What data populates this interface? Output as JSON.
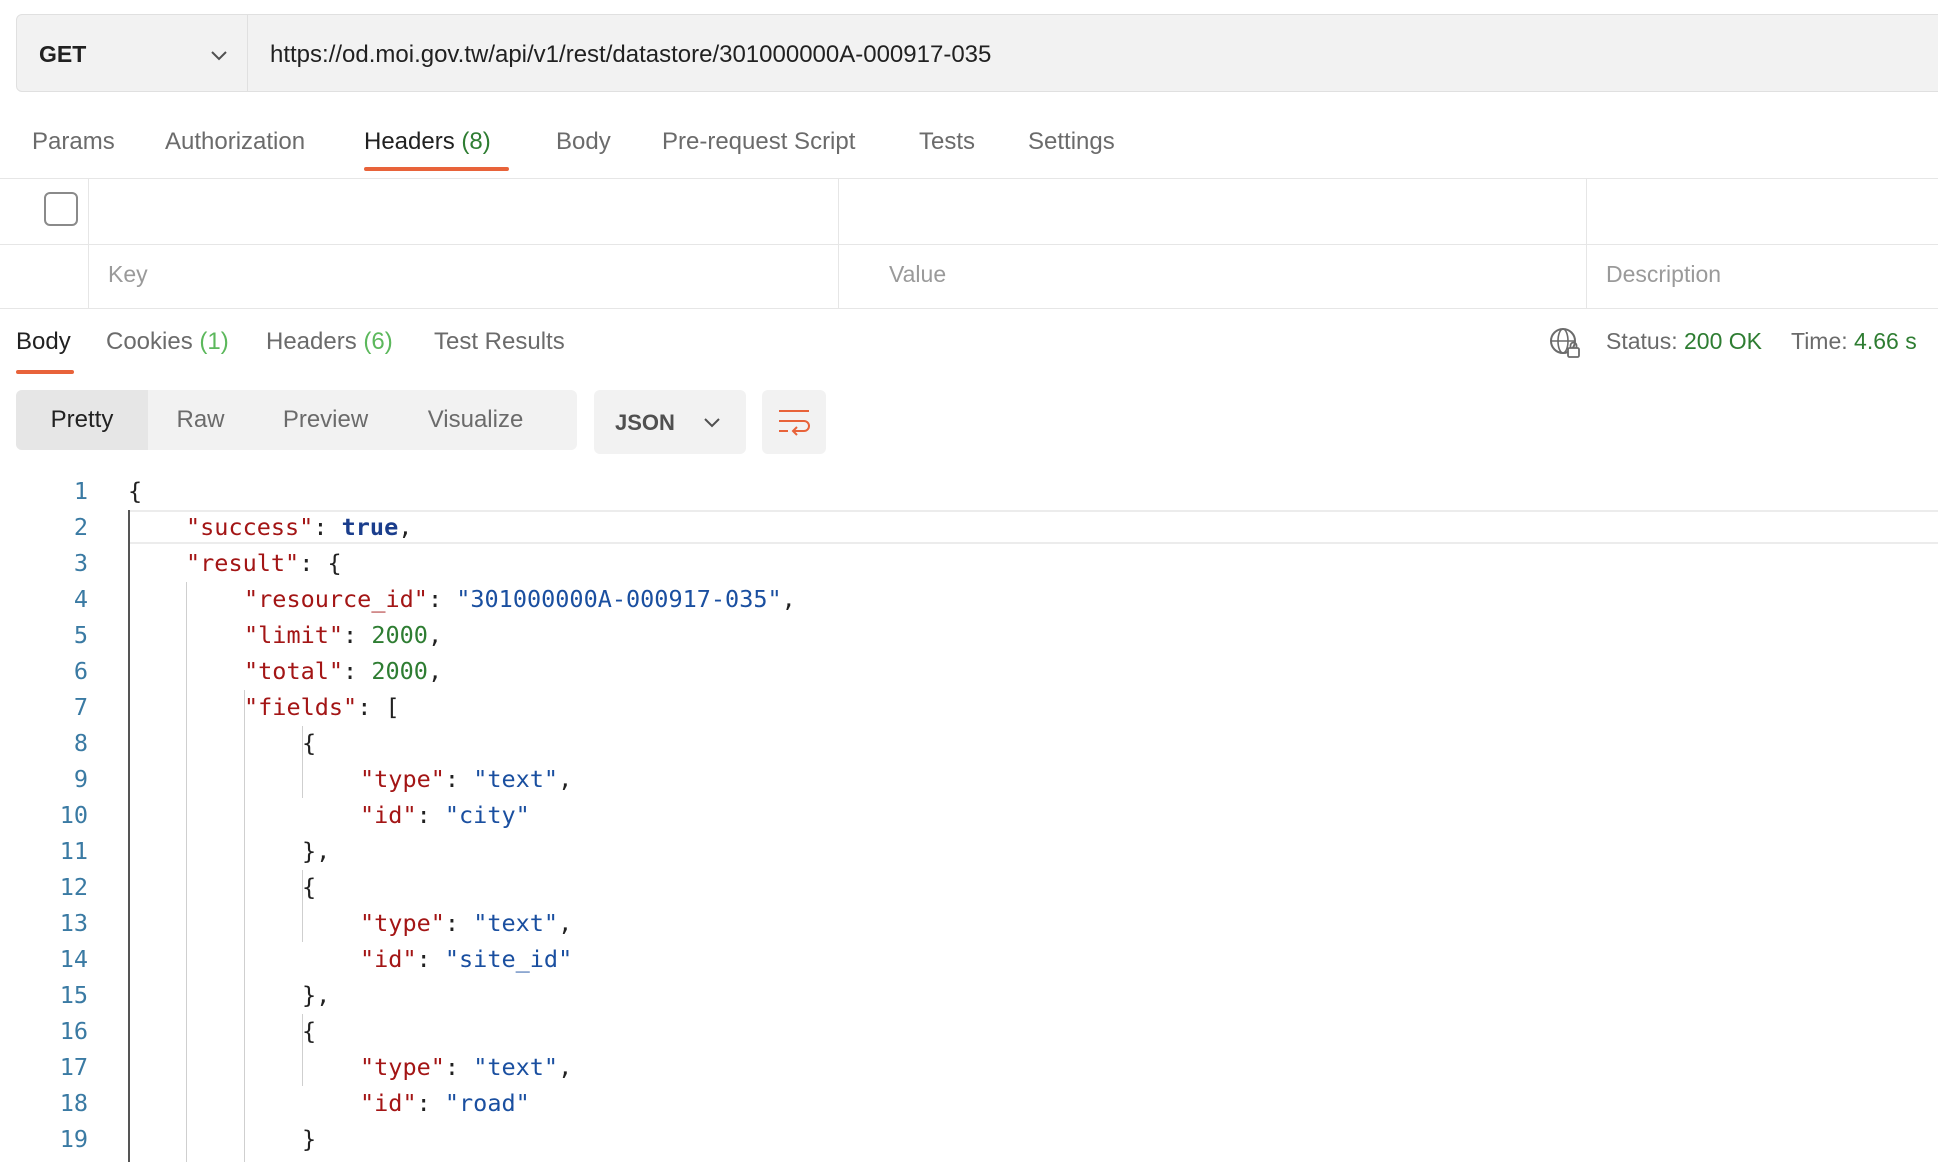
{
  "request": {
    "method": "GET",
    "url": "https://od.moi.gov.tw/api/v1/rest/datastore/301000000A-000917-035"
  },
  "request_tabs": [
    {
      "label": "Params",
      "count": ""
    },
    {
      "label": "Authorization",
      "count": ""
    },
    {
      "label": "Headers",
      "count": "(8)"
    },
    {
      "label": "Body",
      "count": ""
    },
    {
      "label": "Pre-request Script",
      "count": ""
    },
    {
      "label": "Tests",
      "count": ""
    },
    {
      "label": "Settings",
      "count": ""
    }
  ],
  "headers_table": {
    "key_placeholder": "Key",
    "value_placeholder": "Value",
    "description_placeholder": "Description"
  },
  "response_tabs": [
    {
      "label": "Body",
      "count": ""
    },
    {
      "label": "Cookies",
      "count": "(1)"
    },
    {
      "label": "Headers",
      "count": "(6)"
    },
    {
      "label": "Test Results",
      "count": ""
    }
  ],
  "response_status": {
    "status_label": "Status:",
    "status_value": "200 OK",
    "time_label": "Time:",
    "time_value": "4.66 s"
  },
  "view_modes": [
    "Pretty",
    "Raw",
    "Preview",
    "Visualize"
  ],
  "format": "JSON",
  "icons": {
    "globe": "globe-lock-icon",
    "wrap": "wrap-lines-icon",
    "chevron": "chevron-down-icon"
  },
  "colors": {
    "accent": "#e8633a",
    "status_green": "#2e7d32",
    "json_key": "#a31515",
    "json_string": "#1a4fa0",
    "json_number": "#2e7d32"
  },
  "code_lines": [
    {
      "num": "1",
      "indent": 0,
      "tokens": [
        {
          "t": "p",
          "v": "{"
        }
      ]
    },
    {
      "num": "2",
      "indent": 1,
      "tokens": [
        {
          "t": "k",
          "v": "\"success\""
        },
        {
          "t": "p",
          "v": ": "
        },
        {
          "t": "b",
          "v": "true"
        },
        {
          "t": "p",
          "v": ","
        }
      ]
    },
    {
      "num": "3",
      "indent": 1,
      "tokens": [
        {
          "t": "k",
          "v": "\"result\""
        },
        {
          "t": "p",
          "v": ": {"
        }
      ]
    },
    {
      "num": "4",
      "indent": 2,
      "tokens": [
        {
          "t": "k",
          "v": "\"resource_id\""
        },
        {
          "t": "p",
          "v": ": "
        },
        {
          "t": "s",
          "v": "\"301000000A-000917-035\""
        },
        {
          "t": "p",
          "v": ","
        }
      ]
    },
    {
      "num": "5",
      "indent": 2,
      "tokens": [
        {
          "t": "k",
          "v": "\"limit\""
        },
        {
          "t": "p",
          "v": ": "
        },
        {
          "t": "n",
          "v": "2000"
        },
        {
          "t": "p",
          "v": ","
        }
      ]
    },
    {
      "num": "6",
      "indent": 2,
      "tokens": [
        {
          "t": "k",
          "v": "\"total\""
        },
        {
          "t": "p",
          "v": ": "
        },
        {
          "t": "n",
          "v": "2000"
        },
        {
          "t": "p",
          "v": ","
        }
      ]
    },
    {
      "num": "7",
      "indent": 2,
      "tokens": [
        {
          "t": "k",
          "v": "\"fields\""
        },
        {
          "t": "p",
          "v": ": ["
        }
      ]
    },
    {
      "num": "8",
      "indent": 3,
      "tokens": [
        {
          "t": "p",
          "v": "{"
        }
      ]
    },
    {
      "num": "9",
      "indent": 4,
      "tokens": [
        {
          "t": "k",
          "v": "\"type\""
        },
        {
          "t": "p",
          "v": ": "
        },
        {
          "t": "s",
          "v": "\"text\""
        },
        {
          "t": "p",
          "v": ","
        }
      ]
    },
    {
      "num": "10",
      "indent": 4,
      "tokens": [
        {
          "t": "k",
          "v": "\"id\""
        },
        {
          "t": "p",
          "v": ": "
        },
        {
          "t": "s",
          "v": "\"city\""
        }
      ]
    },
    {
      "num": "11",
      "indent": 3,
      "tokens": [
        {
          "t": "p",
          "v": "},"
        }
      ]
    },
    {
      "num": "12",
      "indent": 3,
      "tokens": [
        {
          "t": "p",
          "v": "{"
        }
      ]
    },
    {
      "num": "13",
      "indent": 4,
      "tokens": [
        {
          "t": "k",
          "v": "\"type\""
        },
        {
          "t": "p",
          "v": ": "
        },
        {
          "t": "s",
          "v": "\"text\""
        },
        {
          "t": "p",
          "v": ","
        }
      ]
    },
    {
      "num": "14",
      "indent": 4,
      "tokens": [
        {
          "t": "k",
          "v": "\"id\""
        },
        {
          "t": "p",
          "v": ": "
        },
        {
          "t": "s",
          "v": "\"site_id\""
        }
      ]
    },
    {
      "num": "15",
      "indent": 3,
      "tokens": [
        {
          "t": "p",
          "v": "},"
        }
      ]
    },
    {
      "num": "16",
      "indent": 3,
      "tokens": [
        {
          "t": "p",
          "v": "{"
        }
      ]
    },
    {
      "num": "17",
      "indent": 4,
      "tokens": [
        {
          "t": "k",
          "v": "\"type\""
        },
        {
          "t": "p",
          "v": ": "
        },
        {
          "t": "s",
          "v": "\"text\""
        },
        {
          "t": "p",
          "v": ","
        }
      ]
    },
    {
      "num": "18",
      "indent": 4,
      "tokens": [
        {
          "t": "k",
          "v": "\"id\""
        },
        {
          "t": "p",
          "v": ": "
        },
        {
          "t": "s",
          "v": "\"road\""
        }
      ]
    },
    {
      "num": "19",
      "indent": 3,
      "tokens": [
        {
          "t": "p",
          "v": "}"
        }
      ]
    }
  ]
}
